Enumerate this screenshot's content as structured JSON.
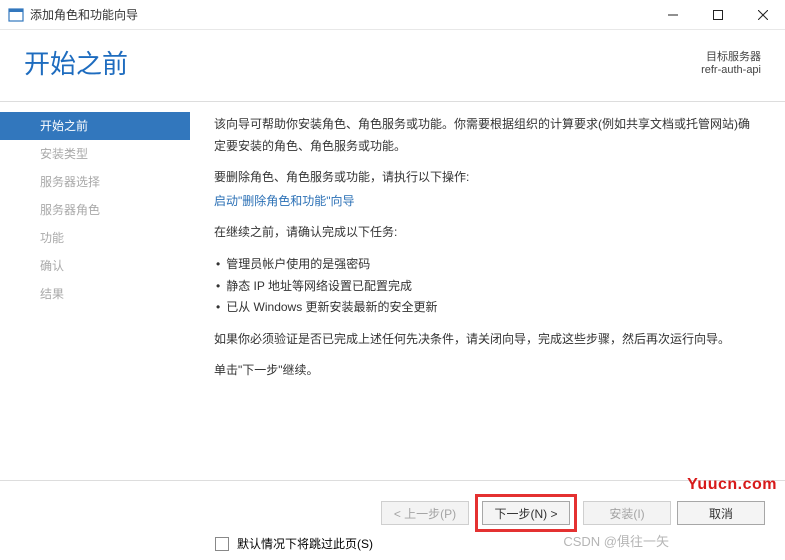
{
  "window": {
    "title": "添加角色和功能向导"
  },
  "header": {
    "heading": "开始之前",
    "target_label": "目标服务器",
    "target_value": "refr-auth-api"
  },
  "sidebar": {
    "steps": [
      {
        "label": "开始之前",
        "active": true
      },
      {
        "label": "安装类型",
        "active": false
      },
      {
        "label": "服务器选择",
        "active": false
      },
      {
        "label": "服务器角色",
        "active": false
      },
      {
        "label": "功能",
        "active": false
      },
      {
        "label": "确认",
        "active": false
      },
      {
        "label": "结果",
        "active": false
      }
    ]
  },
  "content": {
    "intro": "该向导可帮助你安装角色、角色服务或功能。你需要根据组织的计算要求(例如共享文档或托管网站)确定要安装的角色、角色服务或功能。",
    "remove_label": "要删除角色、角色服务或功能，请执行以下操作:",
    "remove_link": "启动\"删除角色和功能\"向导",
    "tasks_label": "在继续之前，请确认完成以下任务:",
    "tasks": [
      "管理员帐户使用的是强密码",
      "静态 IP 地址等网络设置已配置完成",
      "已从 Windows 更新安装最新的安全更新"
    ],
    "verify_text": "如果你必须验证是否已完成上述任何先决条件，请关闭向导，完成这些步骤，然后再次运行向导。",
    "continue_text": "单击\"下一步\"继续。",
    "skip_label": "默认情况下将跳过此页(S)"
  },
  "footer": {
    "prev": "< 上一步(P)",
    "next": "下一步(N) >",
    "install": "安装(I)",
    "cancel": "取消"
  },
  "watermarks": {
    "site": "Yuucn.com",
    "csdn": "CSDN @俱往一矢"
  }
}
